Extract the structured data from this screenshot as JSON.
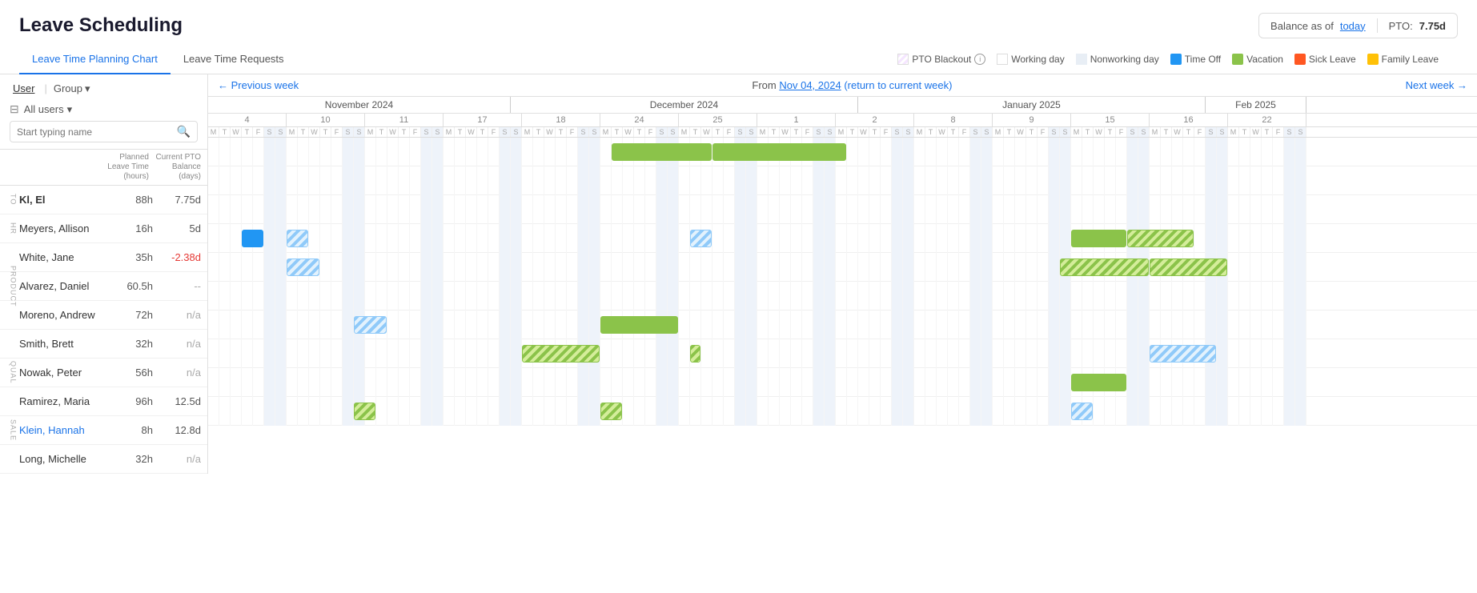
{
  "app": {
    "title": "Leave Scheduling",
    "balance_label": "Balance as of",
    "balance_today": "today",
    "pto_label": "PTO:",
    "pto_value": "7.75d"
  },
  "tabs": [
    {
      "id": "chart",
      "label": "Leave Time Planning Chart",
      "active": true
    },
    {
      "id": "requests",
      "label": "Leave Time Requests",
      "active": false
    }
  ],
  "legend": {
    "items": [
      {
        "id": "pto-blackout",
        "label": "PTO Blackout",
        "type": "pto-blackout"
      },
      {
        "id": "working-day",
        "label": "Working day",
        "type": "working"
      },
      {
        "id": "nonworking-day",
        "label": "Nonworking day",
        "type": "nonworking"
      },
      {
        "id": "time-off",
        "label": "Time Off",
        "type": "blue",
        "color": "#2196f3"
      },
      {
        "id": "vacation",
        "label": "Vacation",
        "type": "solid",
        "color": "#8bc34a"
      },
      {
        "id": "sick-leave",
        "label": "Sick Leave",
        "type": "solid",
        "color": "#ff5722"
      },
      {
        "id": "family-leave",
        "label": "Family Leave",
        "type": "solid",
        "color": "#ffc107"
      }
    ]
  },
  "left_panel": {
    "user_tab": "User",
    "group_btn": "Group",
    "filter_all": "All users",
    "search_placeholder": "Start typing name",
    "col_planned": "Planned Leave Time (hours)",
    "col_pto": "Current PTO Balance (days)"
  },
  "nav": {
    "prev_label": "← Previous week",
    "next_label": "Next week →",
    "from_label": "From",
    "from_date": "Nov 04, 2024",
    "return_label": "(return to current week)"
  },
  "users": [
    {
      "dept": "TO",
      "name": "Kl, El",
      "planned": "88h",
      "pto": "7.75d",
      "pto_class": "",
      "bold": true
    },
    {
      "dept": "HR",
      "name": "Meyers, Allison",
      "planned": "16h",
      "pto": "5d",
      "pto_class": ""
    },
    {
      "dept": "HR",
      "name": "White, Jane",
      "planned": "35h",
      "pto": "-2.38d",
      "pto_class": "negative"
    },
    {
      "dept": "PRODUCT",
      "name": "Alvarez, Daniel",
      "planned": "60.5h",
      "pto": "--",
      "pto_class": "na"
    },
    {
      "dept": "PRODUCT",
      "name": "Moreno, Andrew",
      "planned": "72h",
      "pto": "n/a",
      "pto_class": "na"
    },
    {
      "dept": "PRODUCT",
      "name": "Smith, Brett",
      "planned": "32h",
      "pto": "n/a",
      "pto_class": "na"
    },
    {
      "dept": "QUAL",
      "name": "Nowak, Peter",
      "planned": "56h",
      "pto": "n/a",
      "pto_class": "na"
    },
    {
      "dept": "QUAL",
      "name": "Ramirez, Maria",
      "planned": "96h",
      "pto": "12.5d",
      "pto_class": ""
    },
    {
      "dept": "SALE",
      "name": "Klein, Hannah",
      "planned": "8h",
      "pto": "12.8d",
      "pto_class": "",
      "link": true
    },
    {
      "dept": "SALE",
      "name": "Long, Michelle",
      "planned": "32h",
      "pto": "n/a",
      "pto_class": "na"
    }
  ]
}
